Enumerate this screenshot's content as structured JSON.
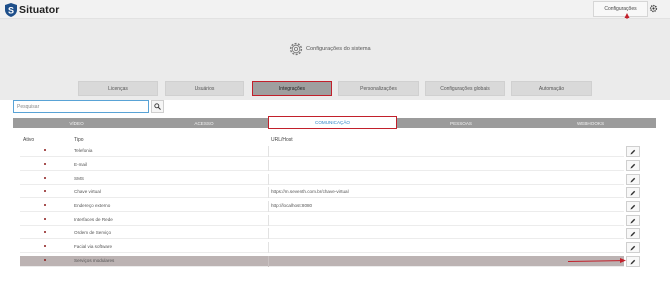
{
  "app": {
    "name": "Situator"
  },
  "topbar": {
    "config_label": "Configurações"
  },
  "page": {
    "title": "Configurações do sistema"
  },
  "tabs": [
    {
      "label": "Licenças"
    },
    {
      "label": "Usuários"
    },
    {
      "label": "Integrações",
      "active": true
    },
    {
      "label": "Personalizações"
    },
    {
      "label": "Configurações globais"
    },
    {
      "label": "Automação"
    }
  ],
  "search": {
    "placeholder": "Pesquisar"
  },
  "subtabs": [
    {
      "label": "VÍDEO"
    },
    {
      "label": "ACESSO"
    },
    {
      "label": "COMUNICAÇÃO",
      "active": true
    },
    {
      "label": "PESSOAS"
    },
    {
      "label": "WEBHOOKS"
    }
  ],
  "table": {
    "columns": {
      "active": "Ativo",
      "type": "Tipo",
      "url": "URL/Host"
    },
    "rows": [
      {
        "type": "Telefonia",
        "url": ""
      },
      {
        "type": "E-mail",
        "url": ""
      },
      {
        "type": "SMS",
        "url": ""
      },
      {
        "type": "Chave virtual",
        "url": "https://m.seventh.com.br/chave-virtual"
      },
      {
        "type": "Endereço externo",
        "url": "http://localhost:8080"
      },
      {
        "type": "Interfaces de Rede",
        "url": ""
      },
      {
        "type": "Ordem de Serviço",
        "url": ""
      },
      {
        "type": "Facial via software",
        "url": ""
      },
      {
        "type": "Serviços modulares",
        "url": "",
        "highlight": true
      }
    ]
  },
  "colors": {
    "accent": "#2f86c9",
    "annotation": "#c2202b",
    "status_dot": "#8b1a1a",
    "highlight_row": "#bcb3b3"
  },
  "icons": {
    "logo": "shield-s-icon",
    "settings": "gear-icon",
    "search": "search-icon",
    "edit": "pencil-icon"
  }
}
